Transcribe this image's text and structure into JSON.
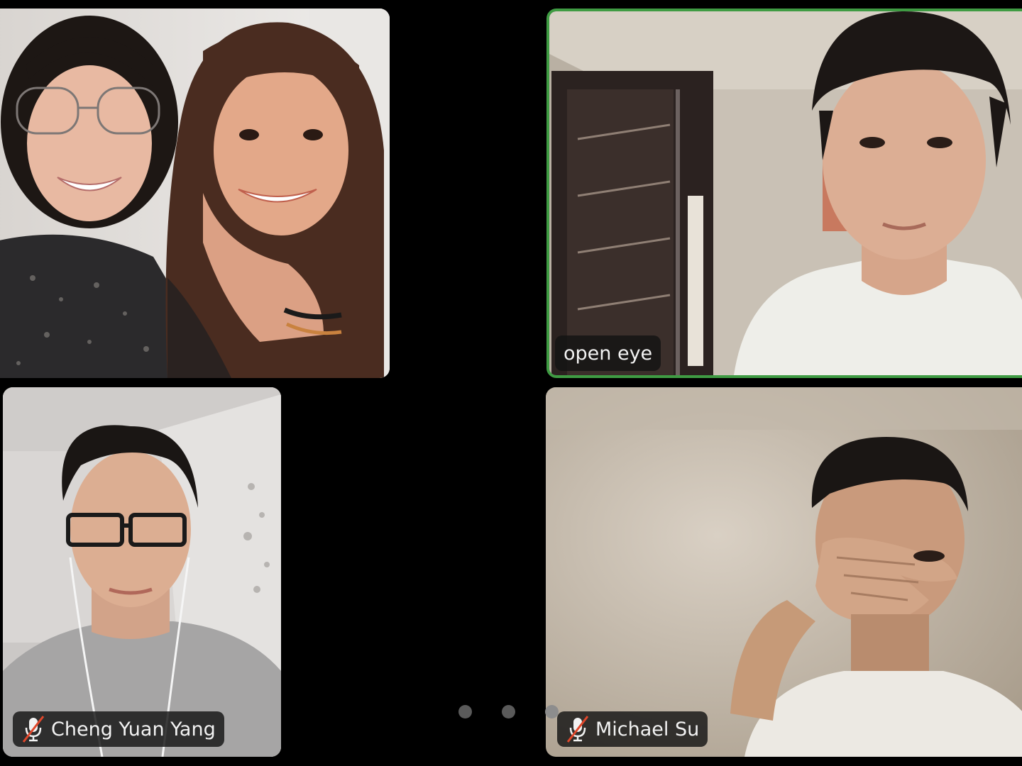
{
  "participants": [
    {
      "name": "",
      "muted": false,
      "active_speaker": false
    },
    {
      "name": "open eye",
      "muted": false,
      "active_speaker": true
    },
    {
      "name": "Cheng Yuan Yang",
      "muted": true,
      "active_speaker": false
    },
    {
      "name": "Michael Su",
      "muted": true,
      "active_speaker": false
    }
  ],
  "icons": {
    "muted_mic": "mic-off-icon"
  },
  "colors": {
    "background": "#000000",
    "active_speaker_border": "#3f9b43",
    "name_label_bg": "#1a1a1a",
    "name_label_text": "#f2f2f2",
    "muted_slash": "#e0472b"
  },
  "pagination": {
    "pages": 3,
    "current_page": 3
  }
}
